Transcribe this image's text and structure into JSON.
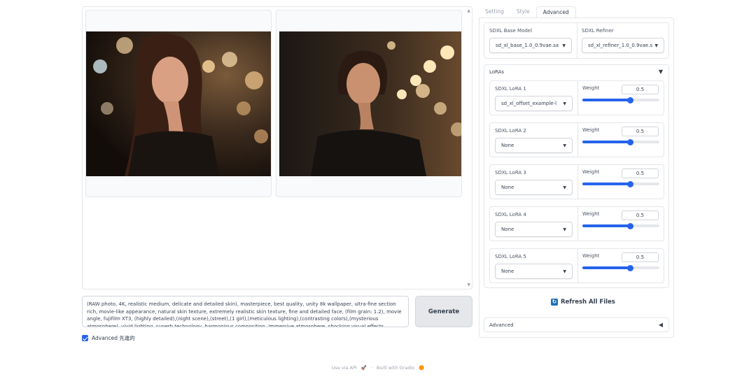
{
  "gallery": {
    "images": [
      {
        "alt": "portrait 1"
      },
      {
        "alt": "portrait 2"
      }
    ]
  },
  "prompt": {
    "value": "(RAW photo, 4K, realistic medium, delicate and detailed skin), masterpiece, best quality, unity 8k wallpaper, ultra-fine section rich, movie-like appearance, natural skin texture, extremely realistic skin texture, fine and detailed face, (film grain: 1.2), movie angle, fujifilm XT3, (highly detailed),(night scene),(street),(1 girl),(meticulous lighting),(contrasting colors),(mysterious atmosphere), vivid lighting, superb technology, harmonious composition, immersive atmosphere, shocking visual effects"
  },
  "generate_label": "Generate",
  "advanced_checkbox": {
    "label": "Advanced 先進的",
    "checked": true
  },
  "tabs": [
    {
      "label": "Setting",
      "active": false
    },
    {
      "label": "Style",
      "active": false
    },
    {
      "label": "Advanced",
      "active": true
    }
  ],
  "models": {
    "base_label": "SDXL Base Model",
    "base_value": "sd_xl_base_1.0_0.9vae.sa",
    "refiner_label": "SDXL Refiner",
    "refiner_value": "sd_xl_refiner_1.0_0.9vae.s"
  },
  "loras": {
    "title": "LoRAs",
    "items": [
      {
        "label": "SDXL LoRA 1",
        "value": "sd_xl_offset_example-l",
        "weight_label": "Weight",
        "weight": "0.5",
        "weight_fraction": 0.62
      },
      {
        "label": "SDXL LoRA 2",
        "value": "None",
        "weight_label": "Weight",
        "weight": "0.5",
        "weight_fraction": 0.62
      },
      {
        "label": "SDXL LoRA 3",
        "value": "None",
        "weight_label": "Weight",
        "weight": "0.5",
        "weight_fraction": 0.62
      },
      {
        "label": "SDXL LoRA 4",
        "value": "None",
        "weight_label": "Weight",
        "weight": "0.5",
        "weight_fraction": 0.62
      },
      {
        "label": "SDXL LoRA 5",
        "value": "None",
        "weight_label": "Weight",
        "weight": "0.5",
        "weight_fraction": 0.62
      }
    ]
  },
  "refresh_label": "Refresh All Files",
  "advanced_accordion": "Advanced",
  "footer": {
    "api": "Use via API",
    "dot": "·",
    "built": "Built with Gradio"
  },
  "colors": {
    "accent": "#2563eb",
    "border": "#e5e7eb"
  }
}
